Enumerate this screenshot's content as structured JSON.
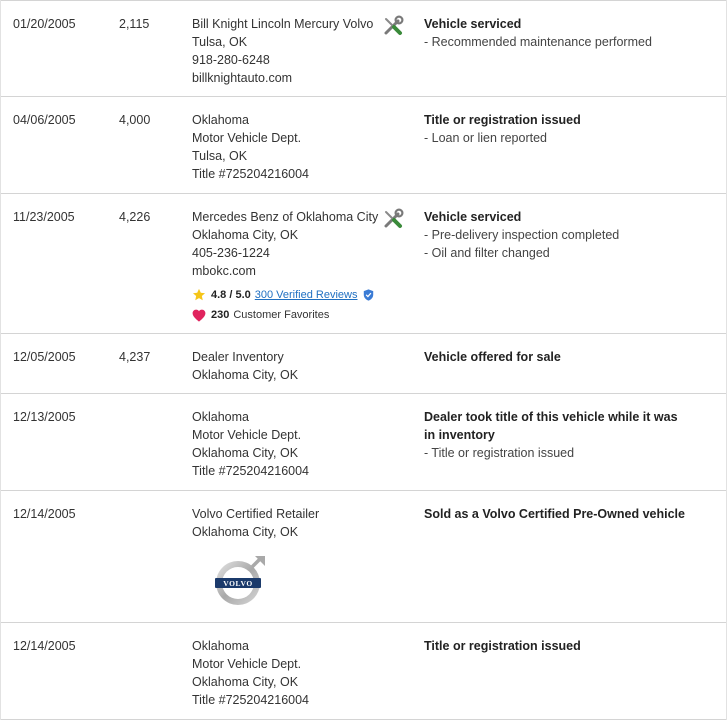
{
  "records": [
    {
      "date": "01/20/2005",
      "mileage": "2,115",
      "source": [
        "Bill Knight Lincoln Mercury Volvo",
        "Tulsa, OK",
        "918-280-6248",
        "billknightauto.com"
      ],
      "icon": "wrench-screwdriver-icon",
      "comment_title": "Vehicle serviced",
      "comment_details": [
        "- Recommended maintenance performed"
      ]
    },
    {
      "date": "04/06/2005",
      "mileage": "4,000",
      "source": [
        "Oklahoma",
        "Motor Vehicle Dept.",
        "Tulsa, OK",
        "Title #725204216004"
      ],
      "icon": "",
      "comment_title": "Title or registration issued",
      "comment_details": [
        "- Loan or lien reported"
      ]
    },
    {
      "date": "11/23/2005",
      "mileage": "4,226",
      "source": [
        "Mercedes Benz of Oklahoma City",
        "Oklahoma City, OK",
        "405-236-1224",
        "mbokc.com"
      ],
      "icon": "wrench-screwdriver-icon",
      "rating": {
        "score": "4.8 / 5.0",
        "reviews_link": "300 Verified Reviews",
        "favorites_count": "230",
        "favorites_label": "Customer Favorites"
      },
      "comment_title": "Vehicle serviced",
      "comment_details": [
        "- Pre-delivery inspection completed",
        "- Oil and filter changed"
      ]
    },
    {
      "date": "12/05/2005",
      "mileage": "4,237",
      "source": [
        "Dealer Inventory",
        "Oklahoma City, OK"
      ],
      "icon": "",
      "comment_title": "Vehicle offered for sale",
      "comment_details": []
    },
    {
      "date": "12/13/2005",
      "mileage": "",
      "source": [
        "Oklahoma",
        "Motor Vehicle Dept.",
        "Oklahoma City, OK",
        "Title #725204216004"
      ],
      "icon": "",
      "comment_title": "Dealer took title of this vehicle while it was in inventory",
      "comment_details": [
        "- Title or registration issued"
      ]
    },
    {
      "date": "12/14/2005",
      "mileage": "",
      "source": [
        "Volvo Certified Retailer",
        "Oklahoma City, OK"
      ],
      "icon": "",
      "logo": {
        "icon": "volvo-logo-icon",
        "text": "VOLVO"
      },
      "comment_title": "Sold as a Volvo Certified Pre-Owned vehicle",
      "comment_details": []
    },
    {
      "date": "12/14/2005",
      "mileage": "",
      "source": [
        "Oklahoma",
        "Motor Vehicle Dept.",
        "Oklahoma City, OK",
        "Title #725204216004"
      ],
      "icon": "",
      "comment_title": "Title or registration issued",
      "comment_details": []
    }
  ],
  "colors": {
    "link": "#1f6fc1",
    "star": "#f5c518",
    "heart": "#e0245e",
    "wrench": "#7a7a7a",
    "screwdriver_handle": "#3a8a3a",
    "border": "#d4d4d4"
  }
}
